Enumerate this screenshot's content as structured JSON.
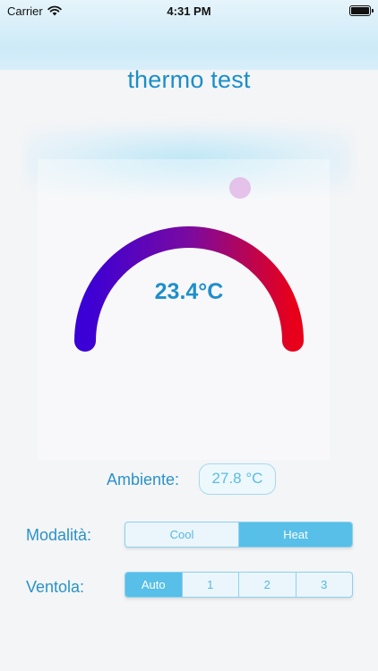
{
  "status_bar": {
    "carrier": "Carrier",
    "time": "4:31 PM",
    "wifi_icon": "wifi-icon",
    "battery_icon": "battery-icon"
  },
  "app": {
    "title": "thermo test"
  },
  "thermostat": {
    "display": "23.4°C",
    "knob_position_fraction": 0.66,
    "colors": {
      "cold": "#3a00d6",
      "mid": "#7a0aa0",
      "hot": "#e8001a"
    }
  },
  "ambient": {
    "label": "Ambiente:",
    "value": "27.8 °C"
  },
  "mode": {
    "label": "Modalità:",
    "options": [
      "Cool",
      "Heat"
    ],
    "selected": "Heat"
  },
  "fan": {
    "label": "Ventola:",
    "options": [
      "Auto",
      "1",
      "2",
      "3"
    ],
    "selected": "Auto"
  },
  "colors": {
    "accent": "#1a8ec9",
    "segment_active": "#57bfe8"
  }
}
